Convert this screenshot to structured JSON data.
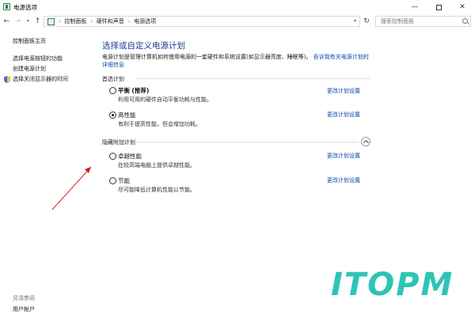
{
  "window": {
    "title": "电源选项"
  },
  "nav": {
    "breadcrumbs": [
      "控制面板",
      "硬件和声音",
      "电源选项"
    ],
    "search_placeholder": "搜索控制面板"
  },
  "sidebar": {
    "items": [
      {
        "label": "控制面板主页"
      },
      {
        "label": "选择电源按钮的功能"
      },
      {
        "label": "创建电源计划"
      },
      {
        "label": "选择关闭显示器的时间"
      }
    ],
    "see_also_label": "另请参阅",
    "see_also_items": [
      {
        "label": "用户帐户"
      }
    ]
  },
  "main": {
    "title": "选择或自定义电源计划",
    "description": "电源计划是管理计算机如何使用电源的一套硬件和系统设置(如显示器亮度、睡眠等)。",
    "description_link": "告诉我有关电源计划的详细信息",
    "selected_group": "首选计划",
    "hidden_group": "隐藏附加计划",
    "plans": [
      {
        "name": "平衡",
        "tag": "(推荐)",
        "desc": "利用可用的硬件自动平衡功耗与性能。",
        "link": "更改计划设置",
        "selected": false
      },
      {
        "name": "高性能",
        "tag": "",
        "desc": "有利于提高性能，但会增加功耗。",
        "link": "更改计划设置",
        "selected": true
      },
      {
        "name": "卓越性能",
        "tag": "",
        "desc": "在较高端电脑上提供卓越性能。",
        "link": "更改计划设置",
        "selected": false
      },
      {
        "name": "节能",
        "tag": "",
        "desc": "尽可能降低计算机性能以节能。",
        "link": "更改计划设置",
        "selected": false
      }
    ]
  },
  "watermark": {
    "text": "ITOPM"
  },
  "colors": {
    "title_blue": "#1e3c96",
    "link_blue": "#0645ad",
    "watermark": "#2ec4b6",
    "arrow": "#d22020"
  }
}
